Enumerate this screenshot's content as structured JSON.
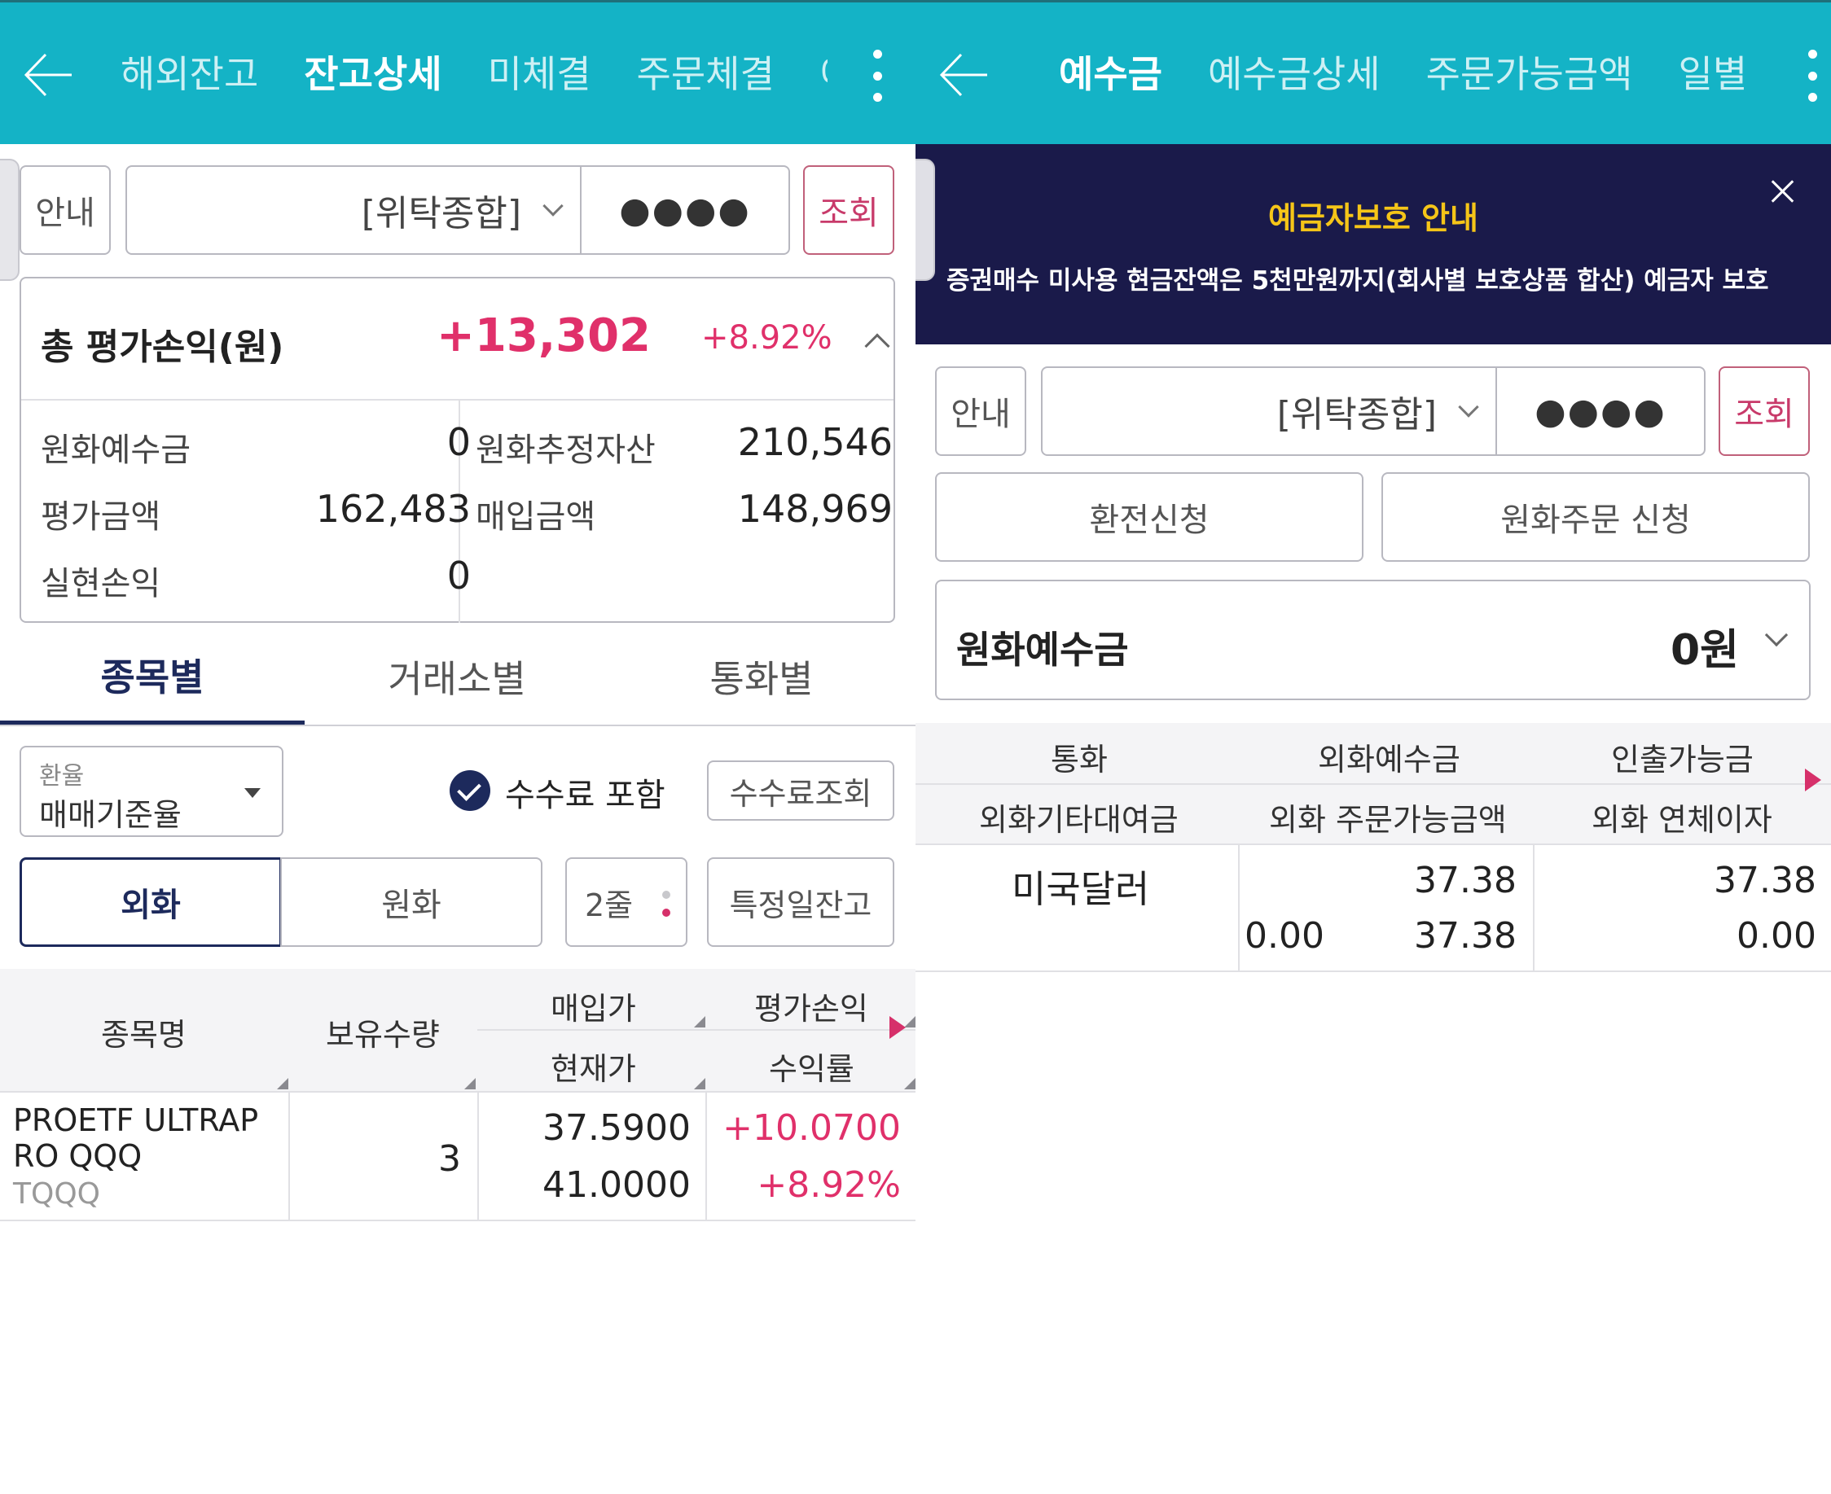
{
  "left": {
    "nav": {
      "tabs": [
        "해외잔고",
        "잔고상세",
        "미체결",
        "주문체결",
        "예"
      ],
      "active_index": 1
    },
    "account": {
      "guide_label": "안내",
      "account_name": "[위탁종합]",
      "password_mask": "●●●●",
      "query_label": "조회"
    },
    "summary": {
      "title": "총 평가손익(원)",
      "total_pl": "+13,302",
      "total_pct": "+8.92%",
      "items": [
        {
          "label": "원화예수금",
          "value": "0"
        },
        {
          "label": "원화추정자산",
          "value": "210,546"
        },
        {
          "label": "평가금액",
          "value": "162,483"
        },
        {
          "label": "매입금액",
          "value": "148,969"
        },
        {
          "label": "실현손익",
          "value": "0"
        }
      ]
    },
    "subtabs": [
      "종목별",
      "거래소별",
      "통화별"
    ],
    "filters": {
      "rate_caption": "환율",
      "rate_value": "매매기준율",
      "fee_include": "수수료 포함",
      "fee_query": "수수료조회",
      "currency_fx": "외화",
      "currency_krw": "원화",
      "lines": "2줄",
      "specific_date": "특정일잔고"
    },
    "table": {
      "headers": {
        "name": "종목명",
        "qty": "보유수량",
        "buy_price": "매입가",
        "cur_price": "현재가",
        "pl": "평가손익",
        "rate": "수익률"
      },
      "rows": [
        {
          "name_line1": "PROETF ULTRAP",
          "name_line2": "RO QQQ",
          "ticker": "TQQQ",
          "qty": "3",
          "buy_price": "37.5900",
          "cur_price": "41.0000",
          "pl": "+10.0700",
          "rate": "+8.92%"
        }
      ]
    }
  },
  "right": {
    "nav": {
      "tabs": [
        "예수금",
        "예수금상세",
        "주문가능금액",
        "일별"
      ],
      "active_index": 0
    },
    "banner": {
      "title": "예금자보호 안내",
      "message": "증권매수 미사용 현금잔액은 5천만원까지(회사별 보호상품 합산) 예금자 보호"
    },
    "account": {
      "guide_label": "안내",
      "account_name": "[위탁종합]",
      "password_mask": "●●●●",
      "query_label": "조회"
    },
    "actions": {
      "exchange": "환전신청",
      "krw_order": "원화주문 신청"
    },
    "deposit": {
      "label": "원화예수금",
      "value": "0원"
    },
    "table": {
      "headers_top": [
        "통화",
        "외화예수금",
        "인출가능금"
      ],
      "headers_bottom": [
        "외화기타대여금",
        "외화 주문가능금액",
        "외화 연체이자"
      ],
      "rows": [
        {
          "currency": "미국달러",
          "other_loan": "0.00",
          "fx_deposit": "37.38",
          "fx_orderable": "37.38",
          "withdrawable": "37.38",
          "overdue_interest": "0.00"
        }
      ]
    }
  },
  "colors": {
    "topbar": "#14b3c6",
    "accent_navy": "#1d2a5c",
    "positive": "#e0306a",
    "banner_bg": "#1a1a4a",
    "banner_title": "#f5c518"
  }
}
